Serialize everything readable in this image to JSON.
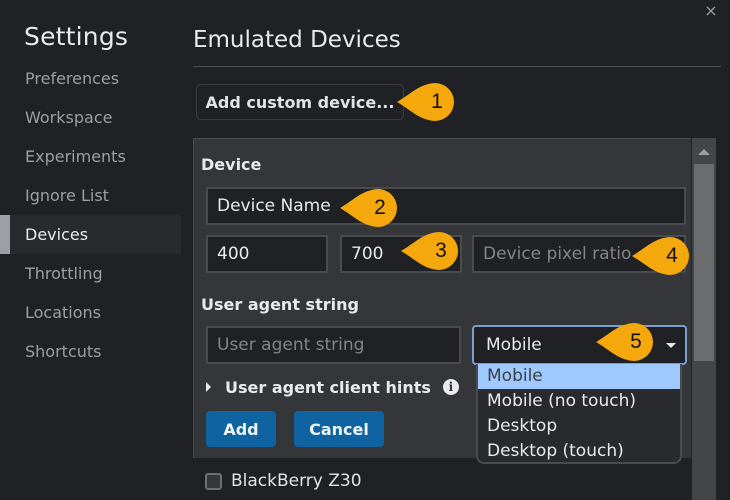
{
  "sidebar": {
    "title": "Settings",
    "items": [
      {
        "label": "Preferences",
        "selected": false
      },
      {
        "label": "Workspace",
        "selected": false
      },
      {
        "label": "Experiments",
        "selected": false
      },
      {
        "label": "Ignore List",
        "selected": false
      },
      {
        "label": "Devices",
        "selected": true
      },
      {
        "label": "Throttling",
        "selected": false
      },
      {
        "label": "Locations",
        "selected": false
      },
      {
        "label": "Shortcuts",
        "selected": false
      }
    ]
  },
  "window": {
    "close_icon": "×"
  },
  "main": {
    "title": "Emulated Devices",
    "add_custom_label": "Add custom device...",
    "editor": {
      "device_section": "Device",
      "device_name_value": "Device Name",
      "width_value": "400",
      "height_value": "700",
      "dpr_placeholder": "Device pixel ratio",
      "ua_section": "User agent string",
      "ua_placeholder": "User agent string",
      "ua_type_selected": "Mobile",
      "ua_type_options": [
        "Mobile",
        "Mobile (no touch)",
        "Desktop",
        "Desktop (touch)"
      ],
      "client_hints_label": "User agent client hints",
      "info_icon": "i",
      "add_label": "Add",
      "cancel_label": "Cancel"
    },
    "devices": [
      {
        "name": "BlackBerry Z30",
        "checked": false
      }
    ]
  },
  "callouts": [
    "1",
    "2",
    "3",
    "4",
    "5"
  ],
  "colors": {
    "accent_button": "#0e63a0",
    "callout": "#f5a80c",
    "dropdown_highlight": "#9fcaff",
    "focus_border": "#7b9fd1"
  }
}
